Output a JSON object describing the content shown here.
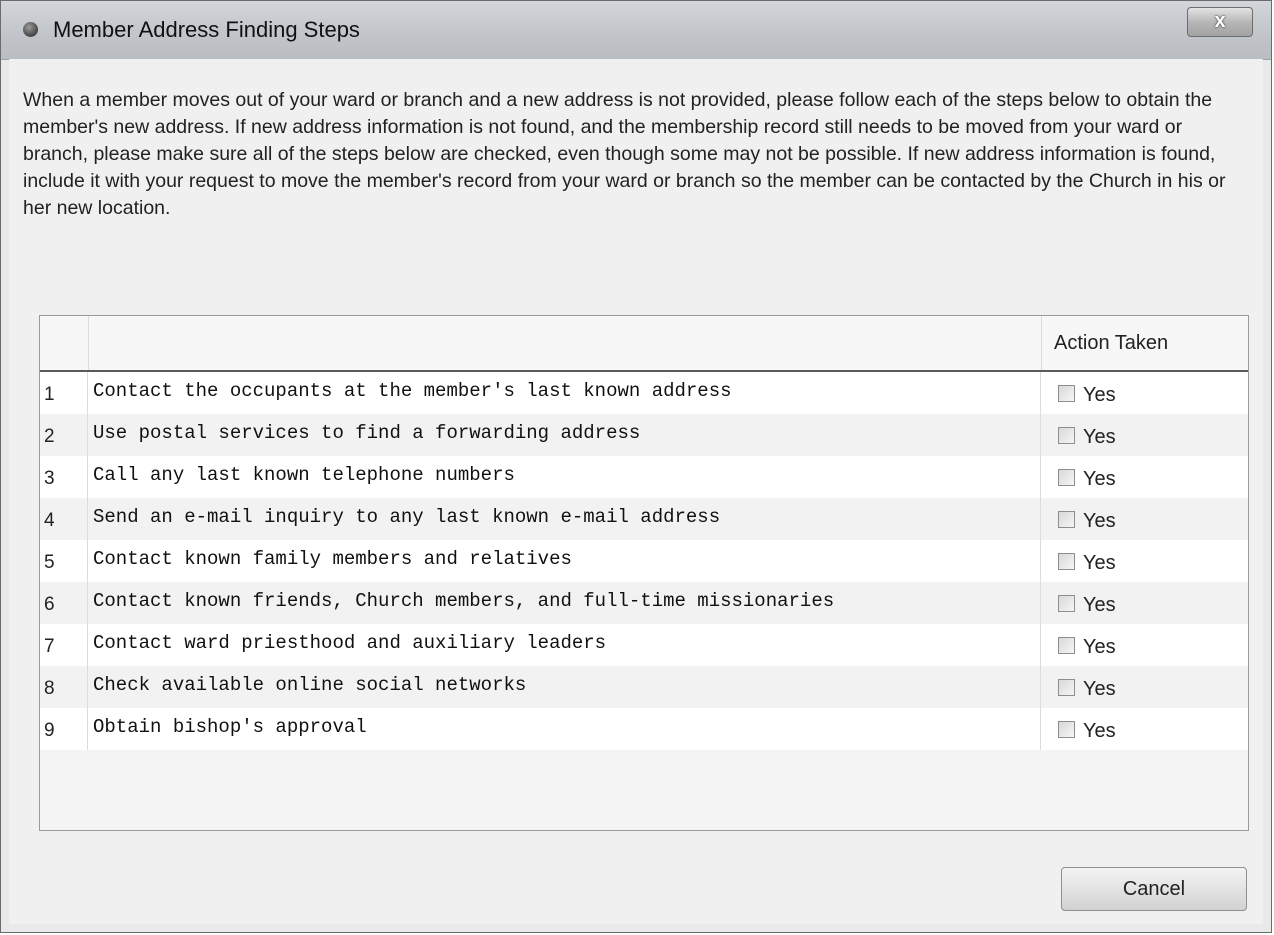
{
  "window": {
    "title": "Member Address Finding Steps",
    "close_label": "x"
  },
  "intro_text": "When a member moves out of your ward or branch and a new address is not provided, please follow each of the steps below to obtain the member's new address. If new address information is not found, and the membership record still needs to be moved from your ward or branch, please make sure all of the steps below are checked, even though some may not be possible. If new address information is found, include it with your request to move the member's record from your ward or branch so the member can be contacted by the Church in his or her new location.",
  "table": {
    "columns": [
      "",
      "",
      "Action Taken"
    ],
    "rows": [
      {
        "num": "1",
        "step": "Contact the occupants at the member's last known address",
        "label": "Yes",
        "checked": false
      },
      {
        "num": "2",
        "step": "Use postal services to find a forwarding address",
        "label": "Yes",
        "checked": false
      },
      {
        "num": "3",
        "step": "Call any last known telephone numbers",
        "label": "Yes",
        "checked": false
      },
      {
        "num": "4",
        "step": "Send an e-mail inquiry to any last known e-mail address",
        "label": "Yes",
        "checked": false
      },
      {
        "num": "5",
        "step": "Contact known family members and relatives",
        "label": "Yes",
        "checked": false
      },
      {
        "num": "6",
        "step": "Contact known friends, Church members, and full-time missionaries",
        "label": "Yes",
        "checked": false
      },
      {
        "num": "7",
        "step": "Contact ward priesthood and auxiliary leaders",
        "label": "Yes",
        "checked": false
      },
      {
        "num": "8",
        "step": "Check available online social networks",
        "label": "Yes",
        "checked": false
      },
      {
        "num": "9",
        "step": "Obtain bishop's approval",
        "label": "Yes",
        "checked": false
      }
    ]
  },
  "footer": {
    "cancel_label": "Cancel"
  }
}
